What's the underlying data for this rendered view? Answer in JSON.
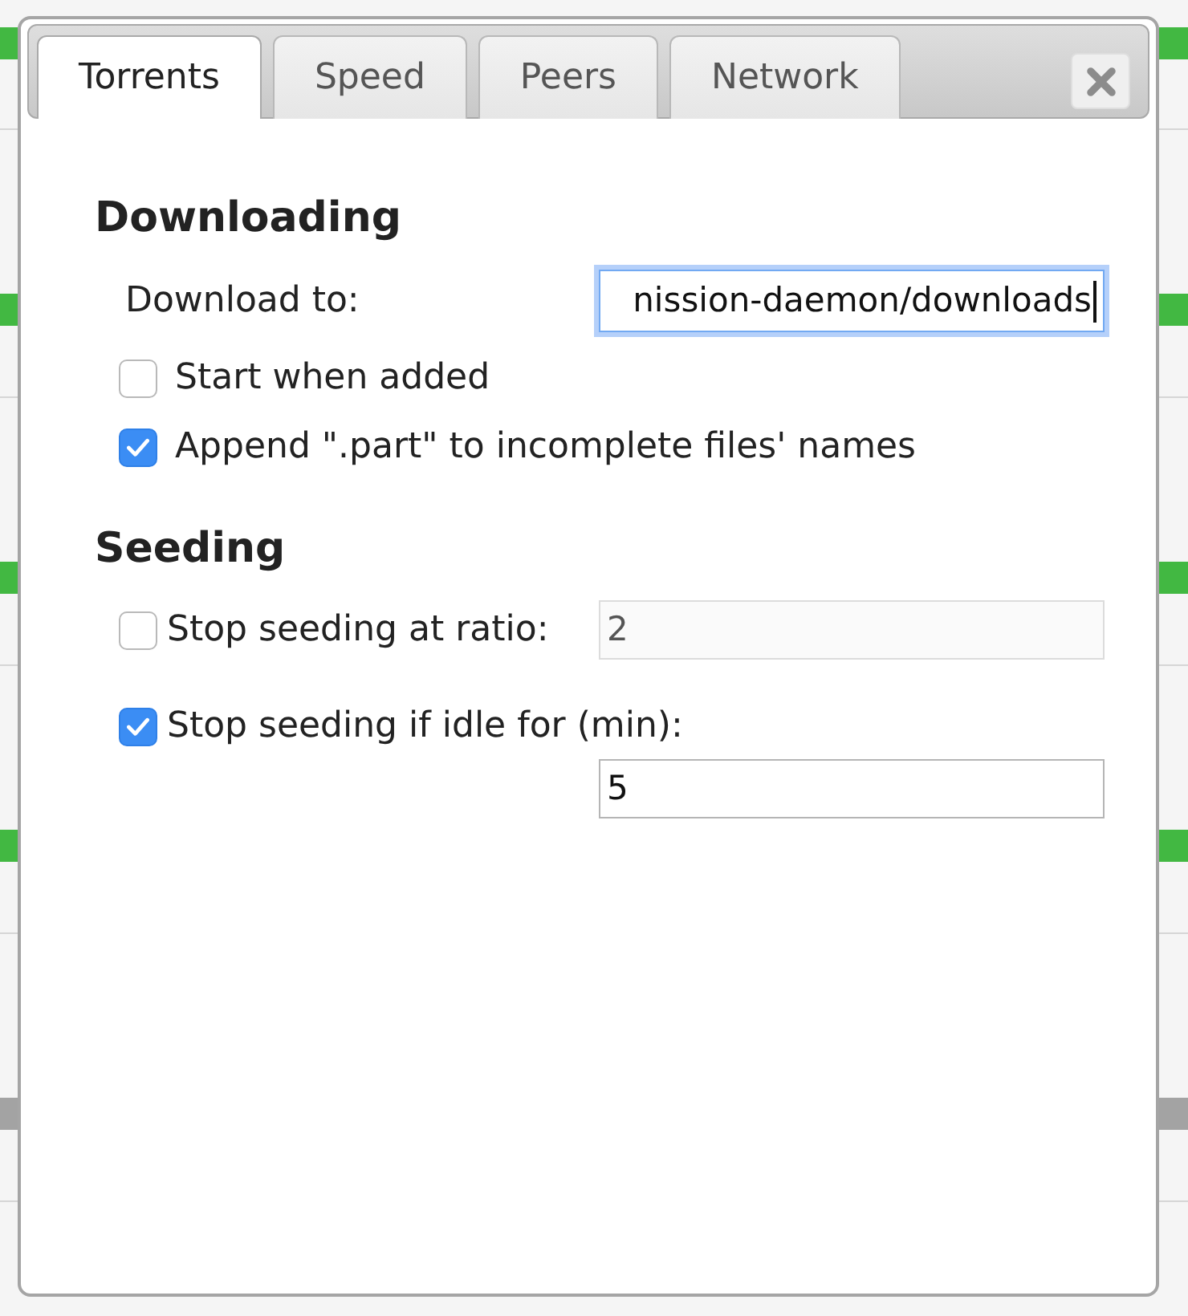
{
  "dialog": {
    "tabs": [
      {
        "label": "Torrents",
        "selected": true
      },
      {
        "label": "Speed",
        "selected": false
      },
      {
        "label": "Peers",
        "selected": false
      },
      {
        "label": "Network",
        "selected": false
      }
    ],
    "sections": [
      {
        "heading": "Downloading",
        "rows": [
          {
            "kind": "field",
            "label": "Download to:",
            "value": "nission-daemon/downloads",
            "focused": true,
            "disabled": false
          },
          {
            "kind": "checkbox",
            "label": "Start when added",
            "checked": false
          },
          {
            "kind": "checkbox",
            "label": "Append \".part\" to incomplete files' names",
            "checked": true
          }
        ]
      },
      {
        "heading": "Seeding",
        "rows": [
          {
            "kind": "checkbox-field",
            "label": "Stop seeding at ratio:",
            "checked": false,
            "value": "2",
            "focused": false,
            "disabled": true
          },
          {
            "kind": "checkbox-field",
            "label": "Stop seeding if idle for (min):",
            "checked": true,
            "value": "5",
            "focused": false,
            "disabled": false
          }
        ]
      }
    ]
  },
  "background_rows": [
    {
      "color": "#42b842"
    },
    {
      "color": "#42b842"
    },
    {
      "color": "#42b842"
    },
    {
      "color": "#42b842"
    },
    {
      "color": "#a3a3a3"
    }
  ]
}
